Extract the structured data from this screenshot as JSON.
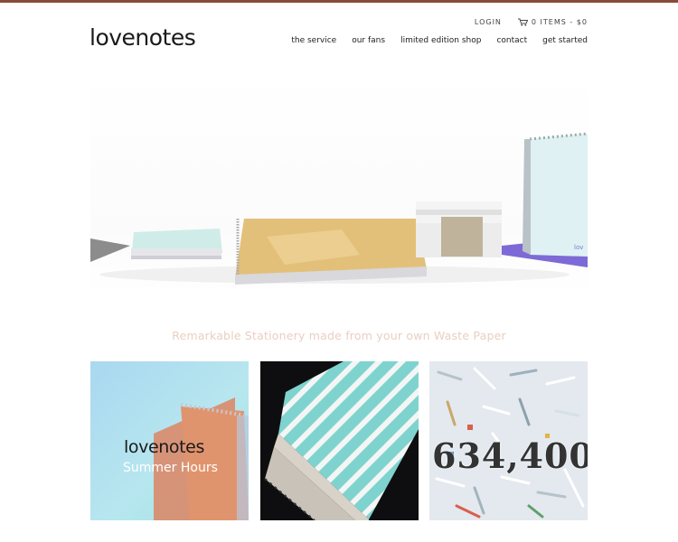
{
  "header": {
    "logo": "lovenotes",
    "login": "LOGIN",
    "cart": "0 ITEMS - $0"
  },
  "nav": {
    "items": [
      "the service",
      "our fans",
      "limited edition shop",
      "contact",
      "get started"
    ]
  },
  "main": {
    "tagline": "Remarkable Stationery made from your own Waste Paper"
  },
  "tiles": {
    "summer_logo": "lovenotes",
    "summer_sub": "Summer Hours",
    "counter": "634,400"
  },
  "colors": {
    "top_bar": "#8a4a3a",
    "tagline": "#e8cfc2"
  }
}
